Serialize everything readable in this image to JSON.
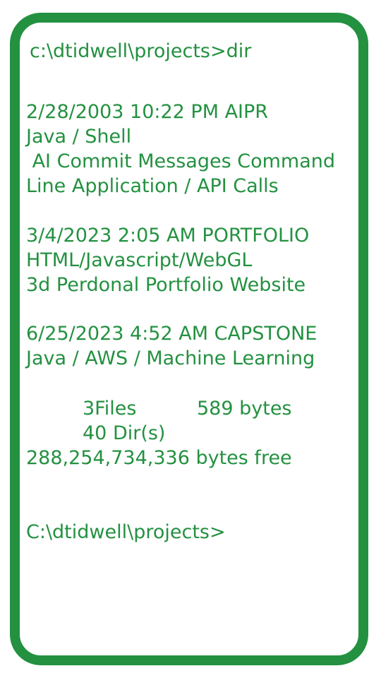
{
  "terminal": {
    "command_prompt": "c:\\dtidwell\\projects>dir",
    "entries": [
      {
        "header": "2/28/2003 10:22 PM AIPR",
        "tech": "Java / Shell",
        "desc_line1": " AI Commit Messages Command",
        "desc_line2": "Line Application / API Calls"
      },
      {
        "header": "3/4/2023 2:05 AM PORTFOLIO",
        "tech": "HTML/Javascript/WebGL",
        "desc_line1": "3d Perdonal Portfolio Website"
      },
      {
        "header": "6/25/2023 4:52 AM CAPSTONE",
        "tech": "Java / AWS / Machine Learning"
      }
    ],
    "summary": {
      "files": "3Files",
      "bytes": "589 bytes",
      "dirs": "40 Dir(s)",
      "free": "288,254,734,336 bytes free"
    },
    "final_prompt": "C:\\dtidwell\\projects>"
  },
  "colors": {
    "accent": "#239140",
    "background": "#ffffff"
  }
}
